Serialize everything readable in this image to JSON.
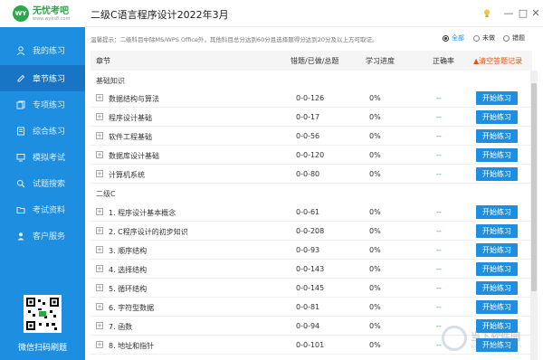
{
  "app": {
    "title": "二级C语言程序设计2022年3月",
    "logo_short": "WY",
    "logo_name": "无忧考吧",
    "logo_url": "www.wyks8.com"
  },
  "window_controls": {
    "minimize": "—",
    "maximize": "□",
    "close": "✕"
  },
  "sidebar": {
    "items": [
      {
        "label": "我的练习",
        "icon": "user-icon",
        "active": false
      },
      {
        "label": "章节练习",
        "icon": "edit-icon",
        "active": true
      },
      {
        "label": "专项练习",
        "icon": "copy-icon",
        "active": false
      },
      {
        "label": "综合练习",
        "icon": "book-icon",
        "active": false
      },
      {
        "label": "模拟考试",
        "icon": "monitor-icon",
        "active": false
      },
      {
        "label": "试题搜索",
        "icon": "search-icon",
        "active": false
      },
      {
        "label": "考试资料",
        "icon": "folder-icon",
        "active": false
      },
      {
        "label": "客户服务",
        "icon": "person-icon",
        "active": false
      }
    ],
    "qr_caption": "微信扫码刷题"
  },
  "notice": "温馨提示：二级科目中除MS/WPS Office外，其他科目总分达到60分且选择题得分达到20分及以上方可取证。",
  "filters": [
    {
      "label": "全部",
      "checked": true
    },
    {
      "label": "未做",
      "checked": false
    },
    {
      "label": "错题",
      "checked": false
    }
  ],
  "table": {
    "headers": {
      "chapter": "章节",
      "progress": "错题/已做/总题",
      "study": "学习进度",
      "accuracy": "正确率",
      "clear": "▲清空答题记录"
    },
    "sections": [
      {
        "title": "基础知识",
        "rows": [
          {
            "name": "数据结构与算法",
            "progress": "0-0-126",
            "pct": "0%",
            "acc": "--",
            "button": "开始练习"
          },
          {
            "name": "程序设计基础",
            "progress": "0-0-17",
            "pct": "0%",
            "acc": "--",
            "button": "开始练习"
          },
          {
            "name": "软件工程基础",
            "progress": "0-0-56",
            "pct": "0%",
            "acc": "--",
            "button": "开始练习"
          },
          {
            "name": "数据库设计基础",
            "progress": "0-0-120",
            "pct": "0%",
            "acc": "--",
            "button": "开始练习"
          },
          {
            "name": "计算机系统",
            "progress": "0-0-80",
            "pct": "0%",
            "acc": "--",
            "button": "开始练习"
          }
        ]
      },
      {
        "title": "二级C",
        "rows": [
          {
            "name": "1. 程序设计基本概念",
            "progress": "0-0-61",
            "pct": "0%",
            "acc": "--",
            "button": "开始练习"
          },
          {
            "name": "2. C程序设计的初步知识",
            "progress": "0-0-208",
            "pct": "0%",
            "acc": "--",
            "button": "开始练习"
          },
          {
            "name": "3. 顺序结构",
            "progress": "0-0-93",
            "pct": "0%",
            "acc": "--",
            "button": "开始练习"
          },
          {
            "name": "4. 选择结构",
            "progress": "0-0-143",
            "pct": "0%",
            "acc": "--",
            "button": "开始练习"
          },
          {
            "name": "5. 循环结构",
            "progress": "0-0-145",
            "pct": "0%",
            "acc": "--",
            "button": "开始练习"
          },
          {
            "name": "6. 字符型数据",
            "progress": "0-0-81",
            "pct": "0%",
            "acc": "--",
            "button": "开始练习"
          },
          {
            "name": "7. 函数",
            "progress": "0-0-94",
            "pct": "0%",
            "acc": "--",
            "button": "开始练习"
          },
          {
            "name": "8. 地址和指针",
            "progress": "0-0-101",
            "pct": "0%",
            "acc": "--",
            "button": "开始练习"
          }
        ]
      }
    ]
  },
  "watermark": {
    "text": "当下软件园",
    "sub": "www.downxia.com"
  }
}
